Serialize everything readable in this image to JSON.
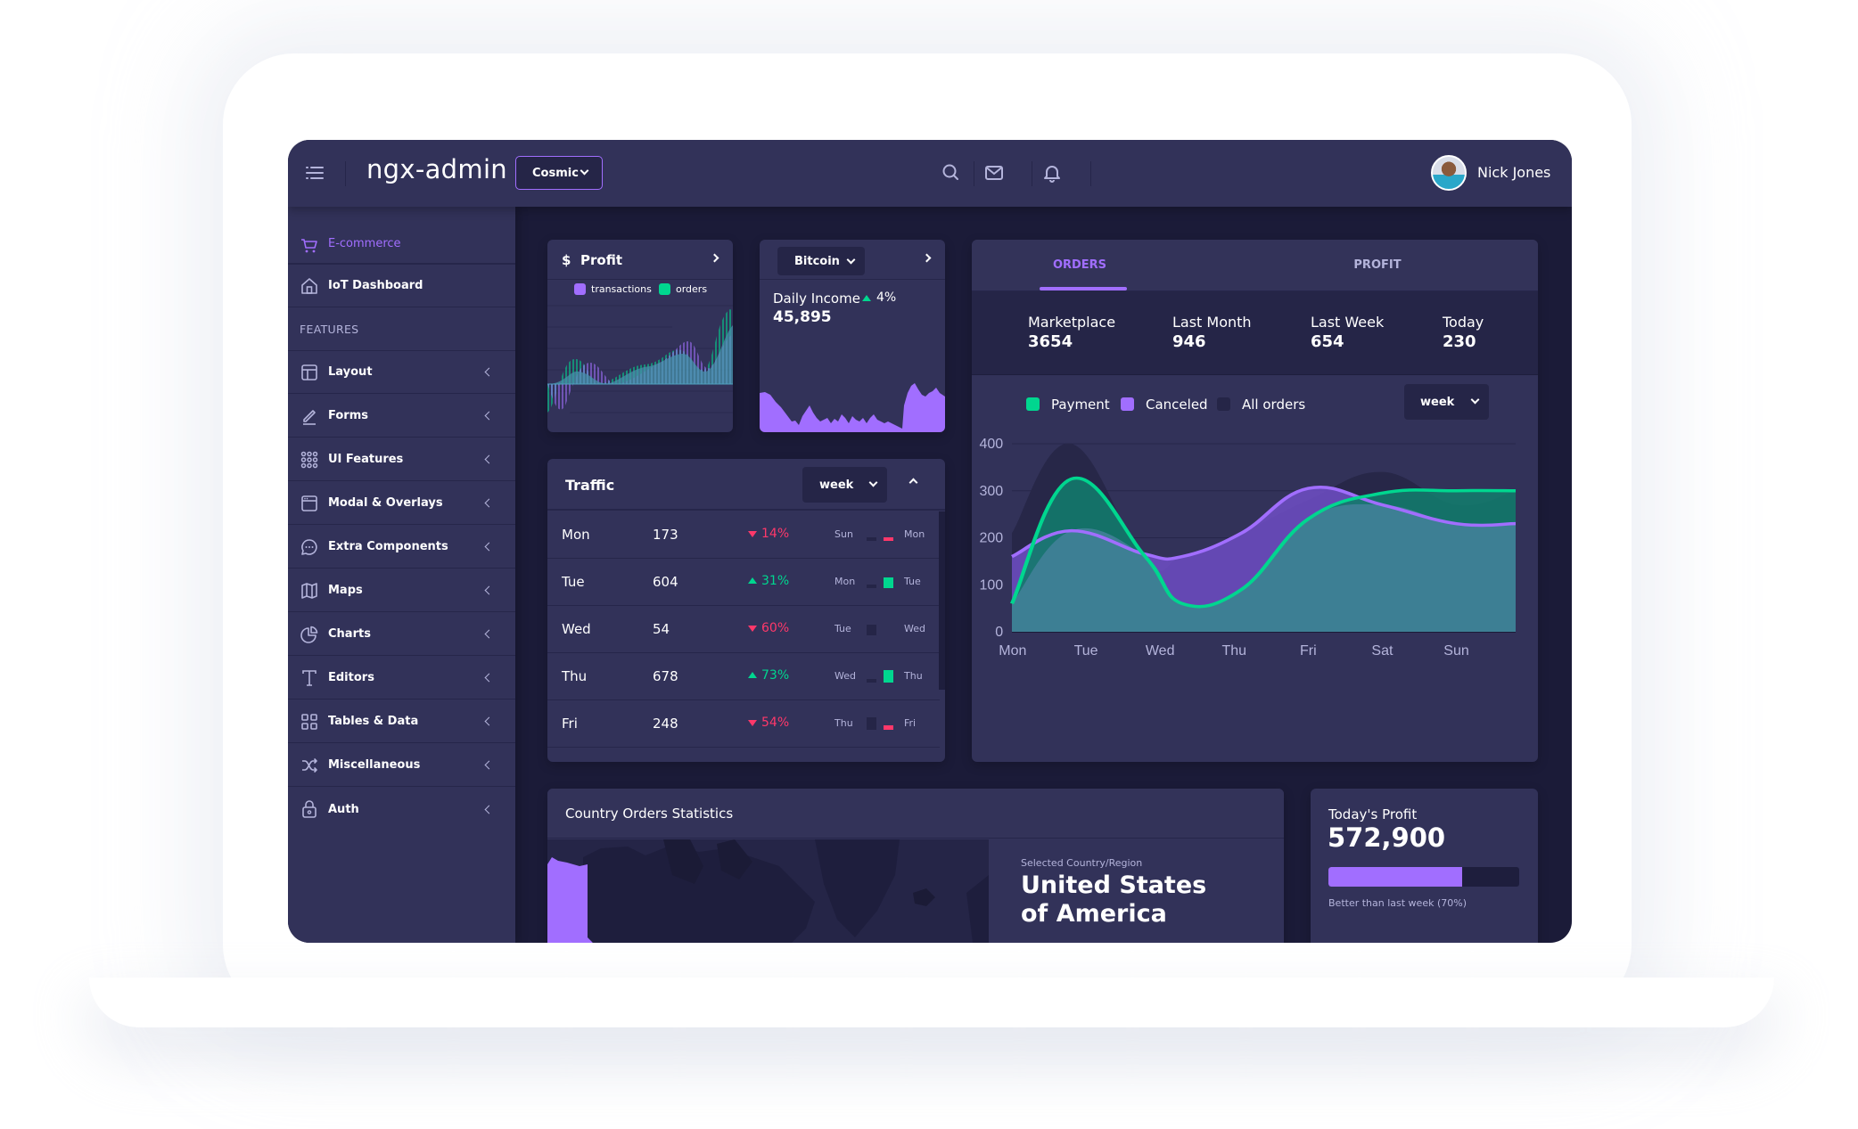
{
  "header": {
    "brand": "ngx-admin",
    "theme_select": "Cosmic",
    "user_name": "Nick Jones",
    "icons": [
      "menu-icon",
      "search-icon",
      "mail-icon",
      "bell-icon"
    ]
  },
  "sidebar": {
    "items": [
      {
        "label": "E-commerce",
        "icon": "shopping-cart-icon",
        "active": true
      },
      {
        "label": "IoT Dashboard",
        "icon": "home-icon"
      }
    ],
    "group_label": "FEATURES",
    "feature_items": [
      {
        "label": "Layout",
        "icon": "layout-icon"
      },
      {
        "label": "Forms",
        "icon": "edit-icon"
      },
      {
        "label": "UI Features",
        "icon": "keypad-icon"
      },
      {
        "label": "Modal & Overlays",
        "icon": "browser-icon"
      },
      {
        "label": "Extra Components",
        "icon": "message-circle-icon"
      },
      {
        "label": "Maps",
        "icon": "map-icon"
      },
      {
        "label": "Charts",
        "icon": "pie-chart-icon"
      },
      {
        "label": "Editors",
        "icon": "text-icon"
      },
      {
        "label": "Tables & Data",
        "icon": "grid-icon"
      },
      {
        "label": "Miscellaneous",
        "icon": "shuffle-icon"
      },
      {
        "label": "Auth",
        "icon": "lock-icon"
      }
    ]
  },
  "profit_card": {
    "currency_symbol": "$",
    "title": "Profit",
    "legend": [
      {
        "label": "transactions",
        "color": "#a16eff"
      },
      {
        "label": "orders",
        "color": "#00d68f"
      }
    ]
  },
  "bitcoin_card": {
    "select": "Bitcoin",
    "label": "Daily Income",
    "value": "45,895",
    "delta": "4%",
    "delta_direction": "up"
  },
  "traffic_card": {
    "title": "Traffic",
    "period_select": "week",
    "rows": [
      {
        "day": "Mon",
        "value": "173",
        "delta": "14%",
        "direction": "down",
        "prev": "Sun",
        "curr": "Mon"
      },
      {
        "day": "Tue",
        "value": "604",
        "delta": "31%",
        "direction": "up",
        "prev": "Mon",
        "curr": "Tue"
      },
      {
        "day": "Wed",
        "value": "54",
        "delta": "60%",
        "direction": "down",
        "prev": "Tue",
        "curr": "Wed"
      },
      {
        "day": "Thu",
        "value": "678",
        "delta": "73%",
        "direction": "up",
        "prev": "Wed",
        "curr": "Thu"
      },
      {
        "day": "Fri",
        "value": "248",
        "delta": "54%",
        "direction": "down",
        "prev": "Thu",
        "curr": "Fri"
      }
    ]
  },
  "orders_card": {
    "tabs": [
      {
        "label": "ORDERS",
        "active": true
      },
      {
        "label": "PROFIT",
        "active": false
      }
    ],
    "stats": [
      {
        "label": "Marketplace",
        "value": "3654"
      },
      {
        "label": "Last Month",
        "value": "946"
      },
      {
        "label": "Last Week",
        "value": "654"
      },
      {
        "label": "Today",
        "value": "230"
      }
    ],
    "legend": [
      {
        "label": "Payment",
        "color": "#00d68f"
      },
      {
        "label": "Canceled",
        "color": "#a16eff"
      },
      {
        "label": "All orders",
        "color": "#252547"
      }
    ],
    "period_select": "week"
  },
  "chart_data": {
    "type": "area",
    "title": "",
    "xlabel": "",
    "ylabel": "",
    "categories": [
      "Mon",
      "Tue",
      "Wed",
      "Thu",
      "Fri",
      "Sat",
      "Sun"
    ],
    "ylim": [
      0,
      400
    ],
    "yticks": [
      0,
      100,
      200,
      300,
      400
    ],
    "grid": true,
    "legend_position": "top-left",
    "x_points": [
      0,
      0.8,
      1.8,
      2.3,
      3.1,
      4.0,
      5.0,
      6.0,
      6.8
    ],
    "series": [
      {
        "name": "All orders",
        "color": "#252547",
        "values": [
          210,
          400,
          150,
          160,
          210,
          280,
          340,
          270,
          300
        ]
      },
      {
        "name": "Canceled",
        "color": "#a16eff",
        "values": [
          160,
          215,
          165,
          160,
          210,
          305,
          270,
          230,
          230
        ]
      },
      {
        "name": "Payment",
        "color": "#00d68f",
        "values": [
          60,
          325,
          160,
          60,
          90,
          240,
          295,
          300,
          300
        ]
      }
    ]
  },
  "country_card": {
    "title": "Country Orders Statistics",
    "selected_label": "Selected Country/Region",
    "selected_country": "United States of America"
  },
  "todays_profit": {
    "title": "Today's Profit",
    "value": "572,900",
    "progress_percent": 70,
    "caption": "Better than last week (70%)"
  }
}
